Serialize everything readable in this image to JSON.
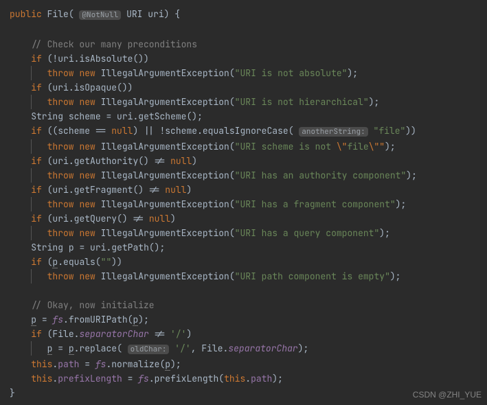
{
  "kw": {
    "public": "public",
    "if": "if",
    "throw": "throw",
    "new": "new",
    "null": "null",
    "this": "this"
  },
  "sig": {
    "cls": "File",
    "ann": "@NotNull",
    "ptype": "URI",
    "pname": "uri"
  },
  "hint": {
    "anotherString": "anotherString:",
    "oldChar": "oldChar:"
  },
  "cmt": {
    "c1": "// Check our many preconditions",
    "c2": "// Okay, now initialize"
  },
  "str": {
    "notabs": "\"URI is not absolute\"",
    "nothier": "\"URI is not hierarchical\"",
    "file": "\"file\"",
    "scheme_a": "\"URI scheme is not ",
    "scheme_b": "\\\"",
    "scheme_c": "file",
    "scheme_d": "\\\"\"",
    "auth": "\"URI has an authority component\"",
    "frag": "\"URI has a fragment component\"",
    "query": "\"URI has a query component\"",
    "empty": "\"\"",
    "pathempty": "\"URI path component is empty\"",
    "slash": "'/'"
  },
  "txt": {
    "IAE": "IllegalArgumentException",
    "String": "String",
    "scheme": "scheme",
    "uri": "uri",
    "getScheme": "getScheme",
    "isAbsolute": "isAbsolute",
    "isOpaque": "isOpaque",
    "equalsIgnoreCase": "equalsIgnoreCase",
    "getAuthority": "getAuthority",
    "getFragment": "getFragment",
    "getQuery": "getQuery",
    "getPath": "getPath",
    "equals": "equals",
    "p": "p",
    "fs": "fs",
    "fromURIPath": "fromURIPath",
    "File": "File",
    "separatorChar": "separatorChar",
    "replace": "replace",
    "path": "path",
    "normalize": "normalize",
    "prefixLength": "prefixLength",
    "comma": ", "
  },
  "watermark": "CSDN @ZHI_YUE"
}
